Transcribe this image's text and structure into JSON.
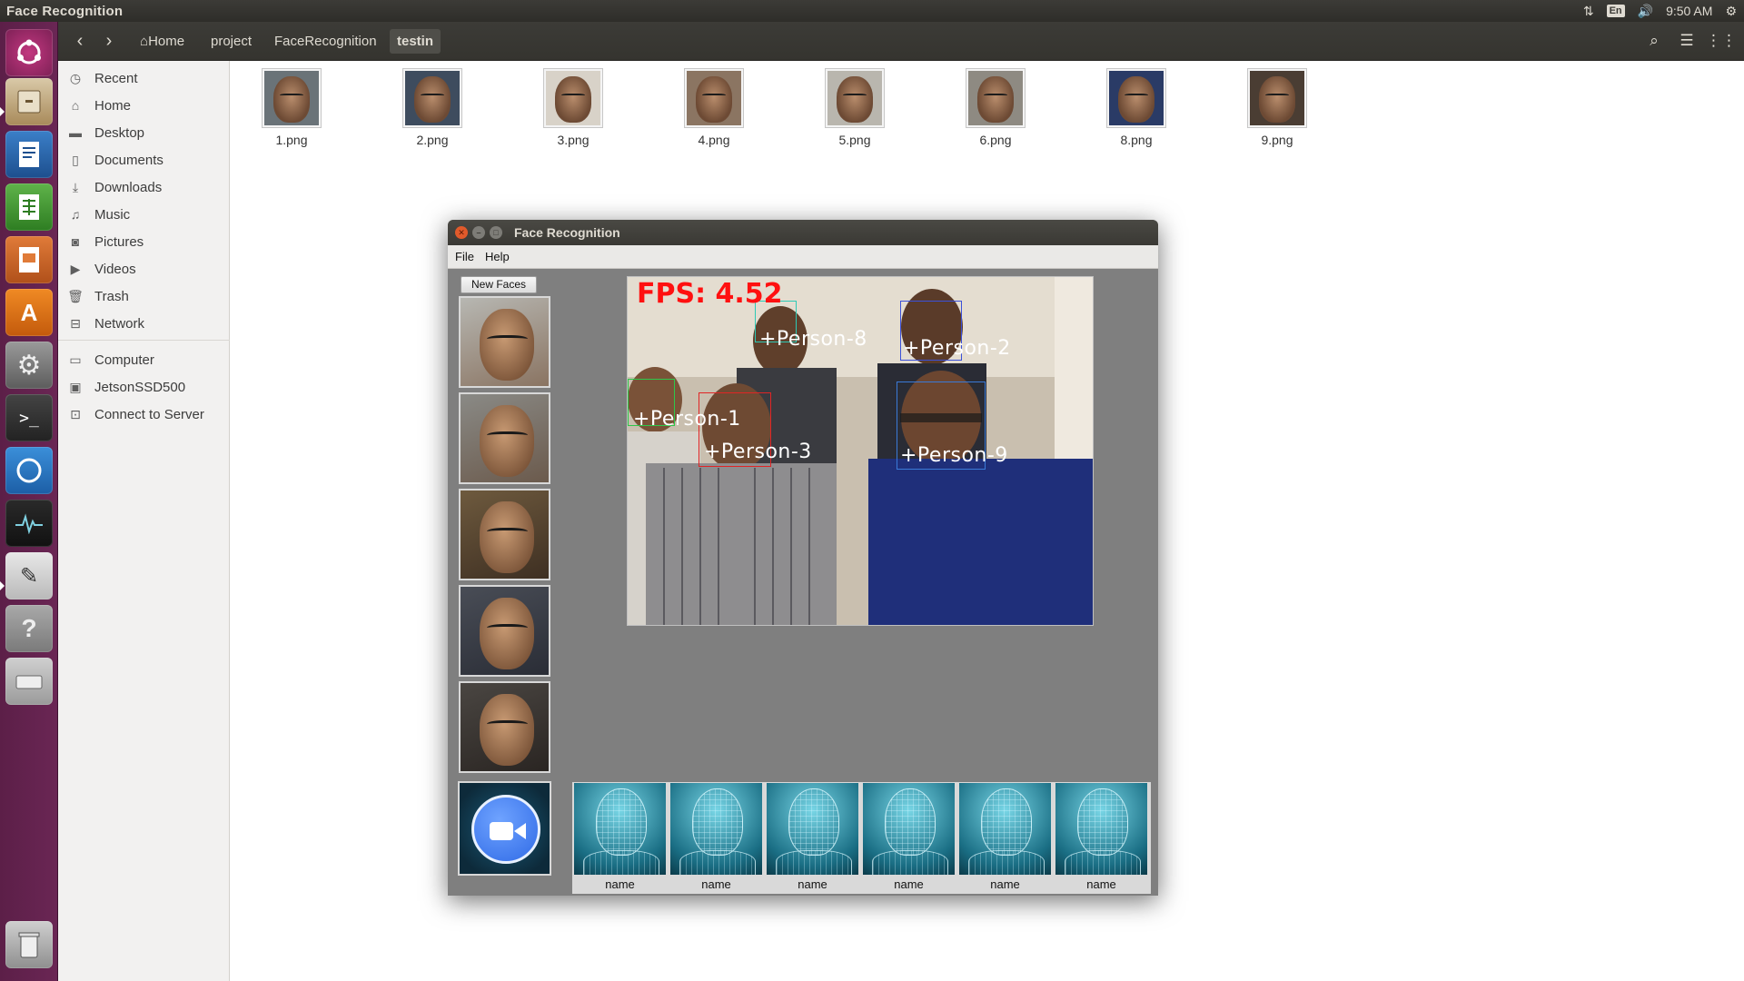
{
  "top_panel": {
    "app_title": "Face Recognition",
    "keyboard_layout": "En",
    "clock": "9:50 AM"
  },
  "launcher": {
    "items": [
      {
        "name": "dash",
        "icon": "ubuntu-logo-icon"
      },
      {
        "name": "files",
        "icon": "file-cabinet-icon"
      },
      {
        "name": "writer",
        "icon": "writer-document-icon"
      },
      {
        "name": "calc",
        "icon": "spreadsheet-icon"
      },
      {
        "name": "impress",
        "icon": "presentation-icon"
      },
      {
        "name": "software-center",
        "icon": "shopping-bag-icon"
      },
      {
        "name": "system-settings",
        "icon": "settings-gear-icon"
      },
      {
        "name": "terminal",
        "icon": "terminal-icon"
      },
      {
        "name": "chromium",
        "icon": "browser-icon"
      },
      {
        "name": "system-monitor",
        "icon": "activity-monitor-icon"
      },
      {
        "name": "text-editor",
        "icon": "text-editor-icon"
      },
      {
        "name": "help",
        "icon": "help-icon"
      },
      {
        "name": "drive",
        "icon": "disk-icon"
      },
      {
        "name": "trash",
        "icon": "trash-icon"
      }
    ]
  },
  "file_manager": {
    "breadcrumbs": [
      "Home",
      "project",
      "FaceRecognition",
      "testin"
    ],
    "sidebar": {
      "places": [
        "Recent",
        "Home",
        "Desktop",
        "Documents",
        "Downloads",
        "Music",
        "Pictures",
        "Videos",
        "Trash",
        "Network"
      ],
      "devices": [
        "Computer",
        "JetsonSSD500",
        "Connect to Server"
      ]
    },
    "files": [
      "1.png",
      "2.png",
      "3.png",
      "4.png",
      "5.png",
      "6.png",
      "8.png",
      "9.png"
    ]
  },
  "face_window": {
    "title": "Face Recognition",
    "menu": [
      "File",
      "Help"
    ],
    "new_faces_button": "New Faces",
    "fps_text": "FPS:  4.52",
    "person_labels": [
      "+Person-8",
      "+Person-2",
      "+Person-1",
      "+Person-3",
      "+Person-9"
    ],
    "known_faces": [
      "name",
      "name",
      "name",
      "name",
      "name",
      "name"
    ]
  }
}
